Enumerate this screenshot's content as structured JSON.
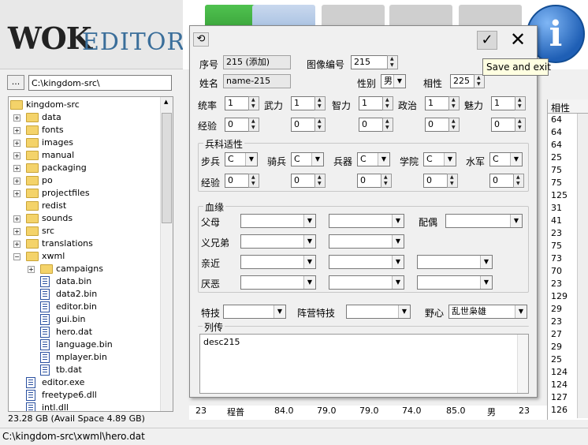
{
  "app": {
    "logo_main": "WOK",
    "logo_sub": "EDITOR"
  },
  "path": {
    "dots_label": "...",
    "value": "C:\\kingdom-src\\"
  },
  "tree": [
    {
      "label": "kingdom-src",
      "depth": 0,
      "type": "folder",
      "exp": ""
    },
    {
      "label": "data",
      "depth": 1,
      "type": "folder",
      "exp": "+"
    },
    {
      "label": "fonts",
      "depth": 1,
      "type": "folder",
      "exp": "+"
    },
    {
      "label": "images",
      "depth": 1,
      "type": "folder",
      "exp": "+"
    },
    {
      "label": "manual",
      "depth": 1,
      "type": "folder",
      "exp": "+"
    },
    {
      "label": "packaging",
      "depth": 1,
      "type": "folder",
      "exp": "+"
    },
    {
      "label": "po",
      "depth": 1,
      "type": "folder",
      "exp": "+"
    },
    {
      "label": "projectfiles",
      "depth": 1,
      "type": "folder",
      "exp": "+"
    },
    {
      "label": "redist",
      "depth": 1,
      "type": "folder",
      "exp": ""
    },
    {
      "label": "sounds",
      "depth": 1,
      "type": "folder",
      "exp": "+"
    },
    {
      "label": "src",
      "depth": 1,
      "type": "folder",
      "exp": "+"
    },
    {
      "label": "translations",
      "depth": 1,
      "type": "folder",
      "exp": "+"
    },
    {
      "label": "xwml",
      "depth": 1,
      "type": "folder",
      "exp": "-"
    },
    {
      "label": "campaigns",
      "depth": 2,
      "type": "folder",
      "exp": "+"
    },
    {
      "label": "data.bin",
      "depth": 2,
      "type": "file",
      "exp": ""
    },
    {
      "label": "data2.bin",
      "depth": 2,
      "type": "file",
      "exp": ""
    },
    {
      "label": "editor.bin",
      "depth": 2,
      "type": "file",
      "exp": ""
    },
    {
      "label": "gui.bin",
      "depth": 2,
      "type": "file",
      "exp": ""
    },
    {
      "label": "hero.dat",
      "depth": 2,
      "type": "file",
      "exp": ""
    },
    {
      "label": "language.bin",
      "depth": 2,
      "type": "file",
      "exp": ""
    },
    {
      "label": "mplayer.bin",
      "depth": 2,
      "type": "file",
      "exp": ""
    },
    {
      "label": "tb.dat",
      "depth": 2,
      "type": "file",
      "exp": ""
    },
    {
      "label": "editor.exe",
      "depth": 1,
      "type": "file",
      "exp": ""
    },
    {
      "label": "freetype6.dll",
      "depth": 1,
      "type": "file",
      "exp": ""
    },
    {
      "label": "intl.dll",
      "depth": 1,
      "type": "file",
      "exp": ""
    }
  ],
  "disk_info": "23.28 GB (Avail Space 4.89 GB)",
  "status_path": "C:\\kingdom-src\\xwml\\hero.dat",
  "right_grid": {
    "header": "相性",
    "values": [
      "64",
      "64",
      "64",
      "25",
      "75",
      "75",
      "125",
      "31",
      "41",
      "23",
      "75",
      "73",
      "70",
      "23",
      "129",
      "29",
      "23",
      "27",
      "29",
      "25",
      "124",
      "124",
      "127",
      "126"
    ]
  },
  "bottom_row": {
    "num": "23",
    "name": "程普",
    "c1": "84.0",
    "c2": "79.0",
    "c3": "79.0",
    "c4": "74.0",
    "c5": "85.0",
    "gender": "男",
    "last": "23"
  },
  "dialog": {
    "undo_icon": "undo-icon",
    "tooltip": "Save and exit",
    "serial_label": "序号",
    "serial_value": "215 (添加)",
    "image_label": "图像编号",
    "image_value": "215",
    "name_label": "姓名",
    "name_value": "name-215",
    "gender_label": "性别",
    "gender_value": "男",
    "affinity_label": "相性",
    "affinity_value": "225",
    "stats": [
      {
        "label": "统率",
        "value": "1",
        "exp": "0"
      },
      {
        "label": "武力",
        "value": "1",
        "exp": "0"
      },
      {
        "label": "智力",
        "value": "1",
        "exp": "0"
      },
      {
        "label": "政治",
        "value": "1",
        "exp": "0"
      },
      {
        "label": "魅力",
        "value": "1",
        "exp": "0"
      }
    ],
    "exp_label": "经验",
    "arms_title": "兵科适性",
    "arms": [
      {
        "label": "步兵",
        "value": "C",
        "exp": "0"
      },
      {
        "label": "骑兵",
        "value": "C",
        "exp": "0"
      },
      {
        "label": "兵器",
        "value": "C",
        "exp": "0"
      },
      {
        "label": "学院",
        "value": "C",
        "exp": "0"
      },
      {
        "label": "水军",
        "value": "C",
        "exp": "0"
      }
    ],
    "blood_title": "血缘",
    "parent_label": "父母",
    "spouse_label": "配偶",
    "brother_label": "义兄弟",
    "close_label": "亲近",
    "hate_label": "厌恶",
    "feature_label": "特技",
    "tactic_label": "阵营特技",
    "ambition_label": "野心",
    "ambition_value": "乱世枭雄",
    "bio_title": "列传",
    "bio_value": "desc215"
  }
}
